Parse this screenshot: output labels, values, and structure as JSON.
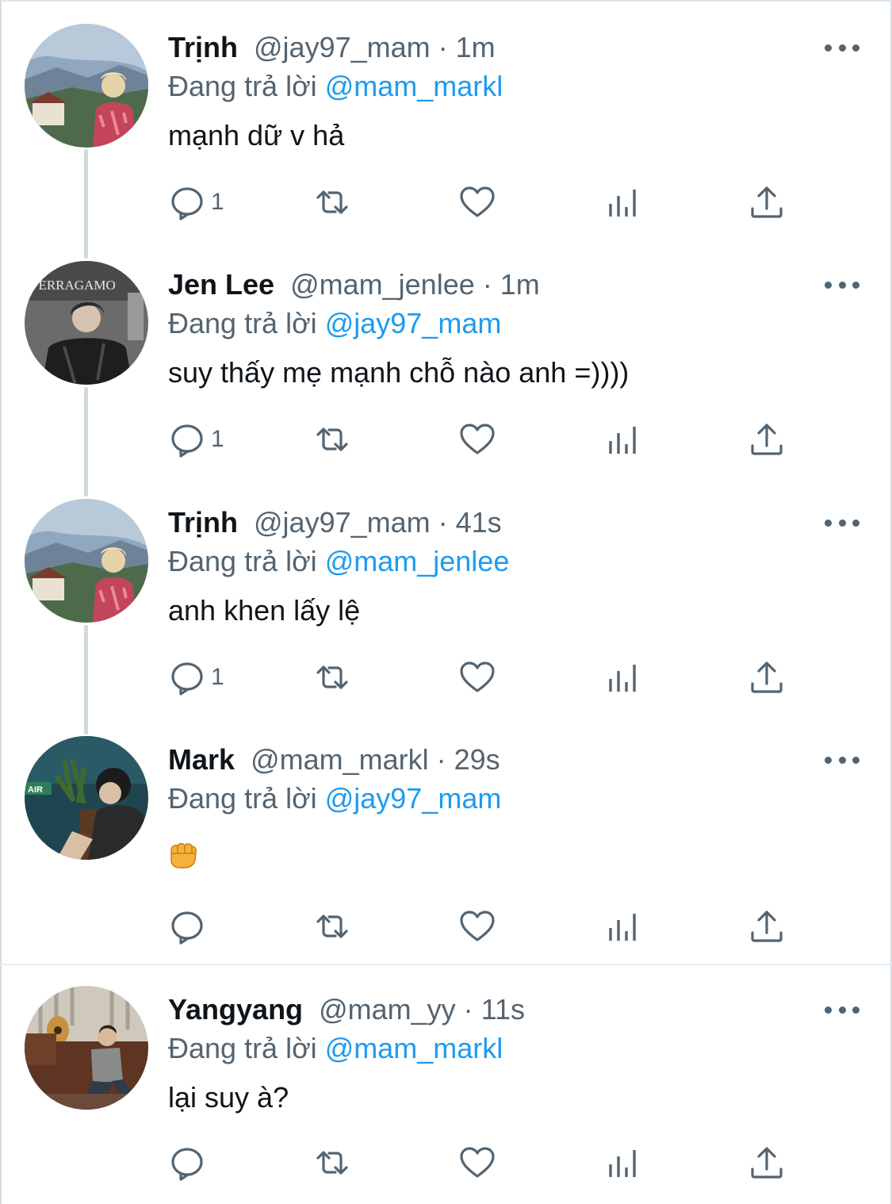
{
  "colors": {
    "accent": "#1d9bf0",
    "secondary_text": "#536471",
    "primary_text": "#0f1419",
    "thread_line": "#cfd9de"
  },
  "tweets": [
    {
      "name": "Trịnh",
      "meta": "@jay97_mam · 1m",
      "reply_prefix": "Đang trả lời",
      "reply_to": "@mam_markl",
      "text": "mạnh dữ v hả",
      "reply_count": "1",
      "avatar": "landscape-profile-avatar"
    },
    {
      "name": "Jen Lee",
      "meta": "@mam_jenlee · 1m",
      "reply_prefix": "Đang trả lời",
      "reply_to": "@jay97_mam",
      "text": "suy thấy mẹ mạnh chỗ nào anh =))))",
      "reply_count": "1",
      "avatar": "dark-jacket-avatar",
      "avatar_sign_text": "FERRAGAMO"
    },
    {
      "name": "Trịnh",
      "meta": "@jay97_mam · 41s",
      "reply_prefix": "Đang trả lời",
      "reply_to": "@mam_jenlee",
      "text": "anh khen lấy lệ",
      "reply_count": "1",
      "avatar": "landscape-profile-avatar"
    },
    {
      "name": "Mark",
      "meta": "@mam_markl · 29s",
      "reply_prefix": "Đang trả lời",
      "reply_to": "@jay97_mam",
      "text": "",
      "emoji": "fist-bump-emoji",
      "reply_count": "",
      "avatar": "plant-room-avatar",
      "avatar_sign_text": "AIR"
    },
    {
      "name": "Yangyang",
      "meta": "@mam_yy · 11s",
      "reply_prefix": "Đang trả lời",
      "reply_to": "@mam_markl",
      "text": "lại suy à?",
      "reply_count": "",
      "avatar": "sofa-guitar-avatar"
    }
  ],
  "action_icons": [
    "reply-icon",
    "retweet-icon",
    "like-icon",
    "analytics-icon",
    "share-icon"
  ]
}
